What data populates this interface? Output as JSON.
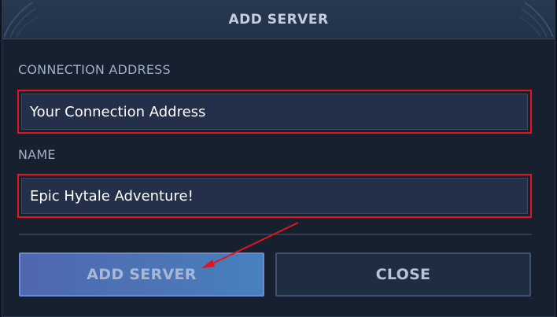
{
  "dialog": {
    "title": "ADD SERVER"
  },
  "fields": {
    "address": {
      "label": "CONNECTION ADDRESS",
      "value": "Your Connection Address"
    },
    "name": {
      "label": "NAME",
      "value": "Epic Hytale Adventure!"
    }
  },
  "buttons": {
    "add_label": "ADD SERVER",
    "close_label": "CLOSE"
  },
  "colors": {
    "highlight": "#e3141c",
    "accent": "#4f67b1"
  }
}
